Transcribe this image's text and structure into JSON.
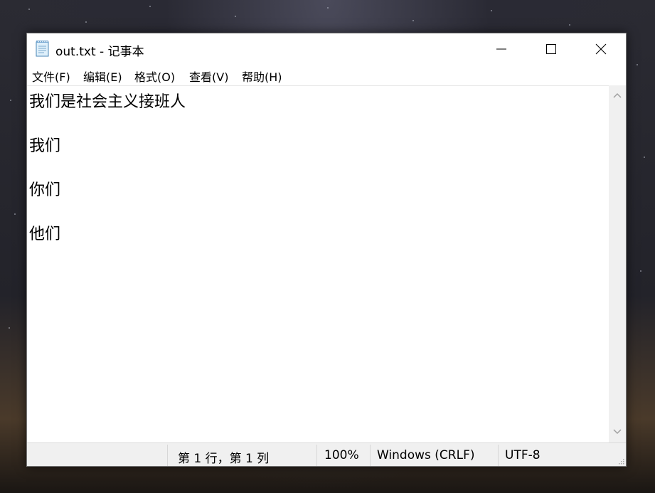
{
  "window": {
    "title": "out.txt - 记事本",
    "icons": {
      "app": "notepad-icon",
      "minimize": "minimize-icon",
      "maximize": "maximize-icon",
      "close": "close-icon"
    }
  },
  "menu": {
    "file": "文件(F)",
    "edit": "编辑(E)",
    "format": "格式(O)",
    "view": "查看(V)",
    "help": "帮助(H)"
  },
  "editor": {
    "lines": [
      "我们是社会主义接班人",
      "我们",
      "你们",
      "他们"
    ]
  },
  "statusbar": {
    "position": "第 1 行，第 1 列",
    "zoom": "100%",
    "line_ending": "Windows (CRLF)",
    "encoding": "UTF-8"
  },
  "colors": {
    "window_bg": "#ffffff",
    "statusbar_bg": "#f0f0f0",
    "scrollbar_bg": "#f0f0f0"
  }
}
